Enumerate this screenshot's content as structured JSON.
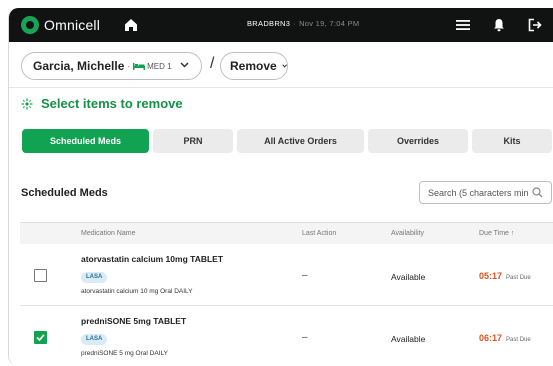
{
  "app": {
    "brand": "Omnicell",
    "station": "BRADBRN3",
    "timestamp": "Nov 19, 7:04 PM"
  },
  "icons": {
    "logo": "omnicell-logo-icon",
    "home": "home-icon",
    "menu": "hamburger-menu-icon",
    "notifications": "bell-icon",
    "logout": "logout-icon",
    "bed": "bed-icon",
    "chevron": "chevron-down-icon",
    "instruction": "select-target-icon",
    "search": "search-icon",
    "sort": "sort-up-arrow-icon",
    "check": "checkmark-icon"
  },
  "colors": {
    "accent": "#12a352",
    "topbar": "#111312",
    "due": "#d9531e",
    "lasa_bg": "#d9ecf6"
  },
  "patient": {
    "name": "Garcia, Michelle",
    "separator": "·",
    "unit": "MED 1"
  },
  "breadcrumb_sep": "/",
  "action": {
    "label": "Remove"
  },
  "instruction": "Select items to remove",
  "tabs": [
    {
      "label": "Scheduled Meds",
      "active": true
    },
    {
      "label": "PRN",
      "active": false
    },
    {
      "label": "All Active Orders",
      "active": false
    },
    {
      "label": "Overrides",
      "active": false
    },
    {
      "label": "Kits",
      "active": false
    }
  ],
  "section_title": "Scheduled Meds",
  "search": {
    "placeholder": "Search (5 characters min"
  },
  "table": {
    "columns": [
      "Medication Name",
      "Last Action",
      "Availability",
      "Due Time"
    ],
    "sort_indicator": "↑",
    "rows": [
      {
        "checked": false,
        "name": "atorvastatin calcium 10mg TABLET",
        "badge": "LASA",
        "description": "atorvastatin calcium 10 mg Oral DAILY",
        "last_action": "–",
        "availability": "Available",
        "due_time": "05:17",
        "due_status": "Past Due"
      },
      {
        "checked": true,
        "name": "predniSONE 5mg TABLET",
        "badge": "LASA",
        "description": "predniSONE 5 mg Oral DAILY",
        "last_action": "–",
        "availability": "Available",
        "due_time": "06:17",
        "due_status": "Past Due"
      }
    ]
  }
}
